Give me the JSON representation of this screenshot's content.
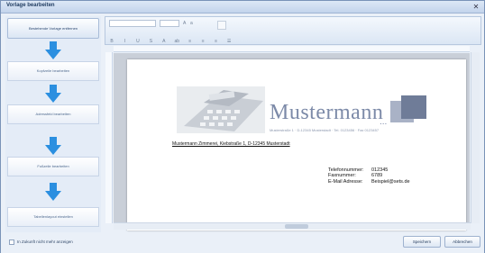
{
  "window": {
    "title": "Vorlage bearbeiten",
    "close_glyph": "✕"
  },
  "steps": {
    "active_label": "Bestehende Vorlage entfernen",
    "items": [
      {
        "label": "Kopfzeile bearbeiten"
      },
      {
        "label": "Adressfeld bearbeiten"
      },
      {
        "label": "Fußzeile bearbeiten"
      },
      {
        "label": "Tabellenlayout einstellen"
      }
    ],
    "arrow_color": "#2b8fe0"
  },
  "document": {
    "brand_name": "Mustermann",
    "brand_dots": "...",
    "brand_address": "Musterstraße 1 · D-12345 Musterstadt · Tel. 0123456 · Fax 0123457",
    "sender_line": "Mustermann Zimmerei, Kiebstraße 1, D-12345 Musterstadt",
    "contact": [
      {
        "key": "Telefonnummer:",
        "value": "012345"
      },
      {
        "key": "Faxnummer:",
        "value": "6789"
      },
      {
        "key": "E-Mail Adresse:",
        "value": "Beispiel@sets.de"
      }
    ]
  },
  "footer": {
    "checkbox_label": "In Zukunft nicht mehr anzeigen",
    "save_button": "Speichern",
    "cancel_button": "Abbrechen"
  },
  "colors": {
    "accent": "#2b8fe0",
    "brand_gray": "#7c8aa8",
    "window_bg": "#eaf0f8"
  }
}
